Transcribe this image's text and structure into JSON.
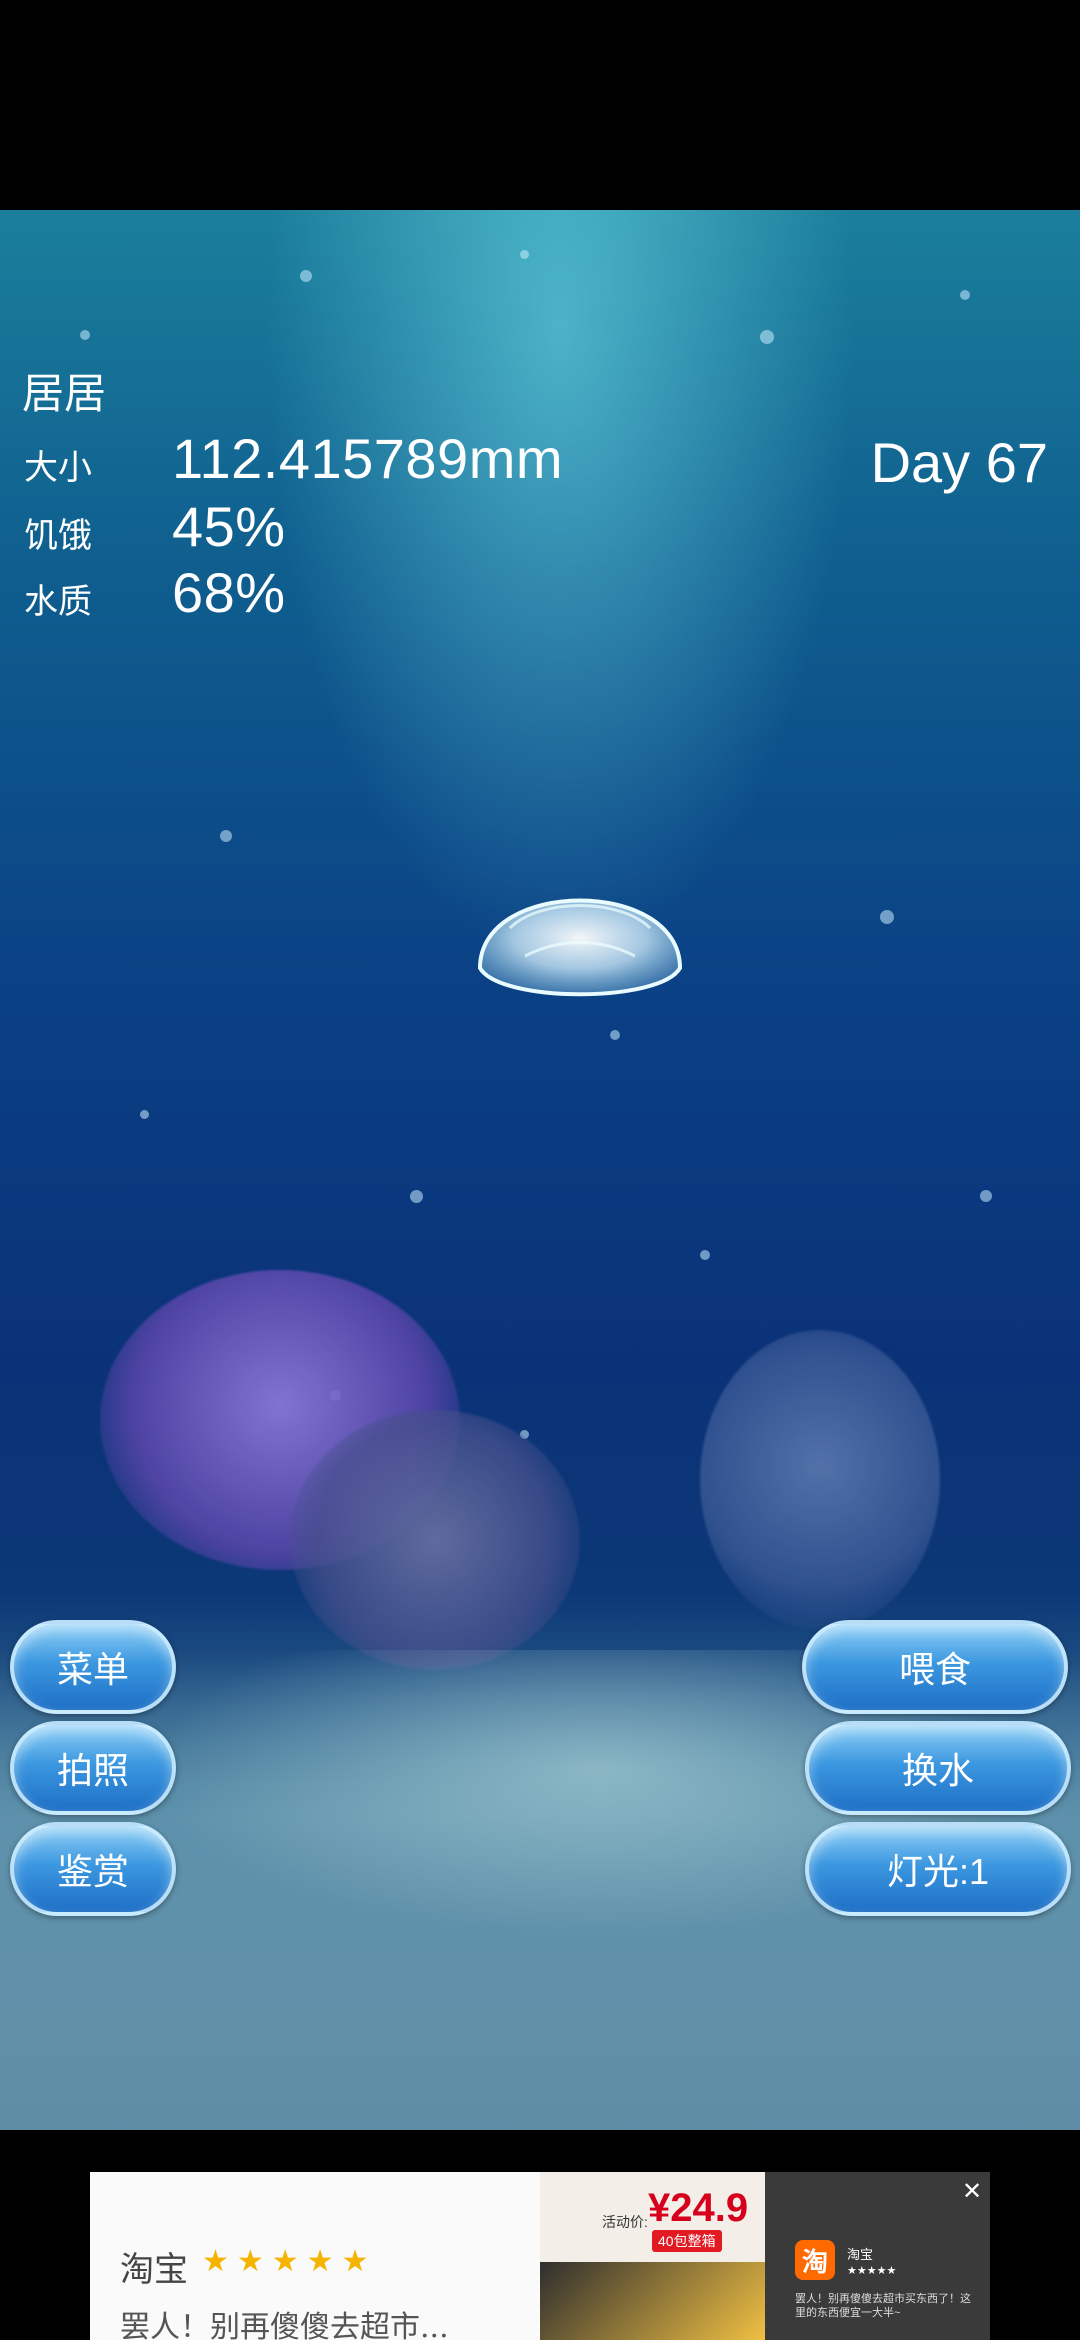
{
  "pet": {
    "name": "居居",
    "stats": [
      {
        "label": "大小",
        "value": "112.415789mm"
      },
      {
        "label": "饥饿",
        "value": "45%"
      },
      {
        "label": "水质",
        "value": "68%"
      }
    ],
    "day": "Day 67"
  },
  "buttons_left": [
    "菜单",
    "拍照",
    "鉴赏"
  ],
  "buttons_right": [
    "喂食",
    "换水",
    "灯光:1"
  ],
  "ad": {
    "brand_script": "淘宝",
    "script_line": "罢人！别再傻傻去超市...",
    "price_label": "活动价:",
    "price": "¥24.9",
    "price_note": "40包整箱",
    "app_name": "淘宝",
    "app_desc": "罢人！别再傻傻去超市买东西了！这里的东西便宜一大半~",
    "app_icon_char": "淘",
    "close_icon": "close-icon",
    "rating_stars": "★★★★★",
    "rating_small": "★★★★★"
  },
  "colors": {
    "button_top": "#8fd0f7",
    "button_bottom": "#1e6fc6",
    "water_deep": "#0a3f84",
    "brand_orange": "#ff6a00"
  }
}
